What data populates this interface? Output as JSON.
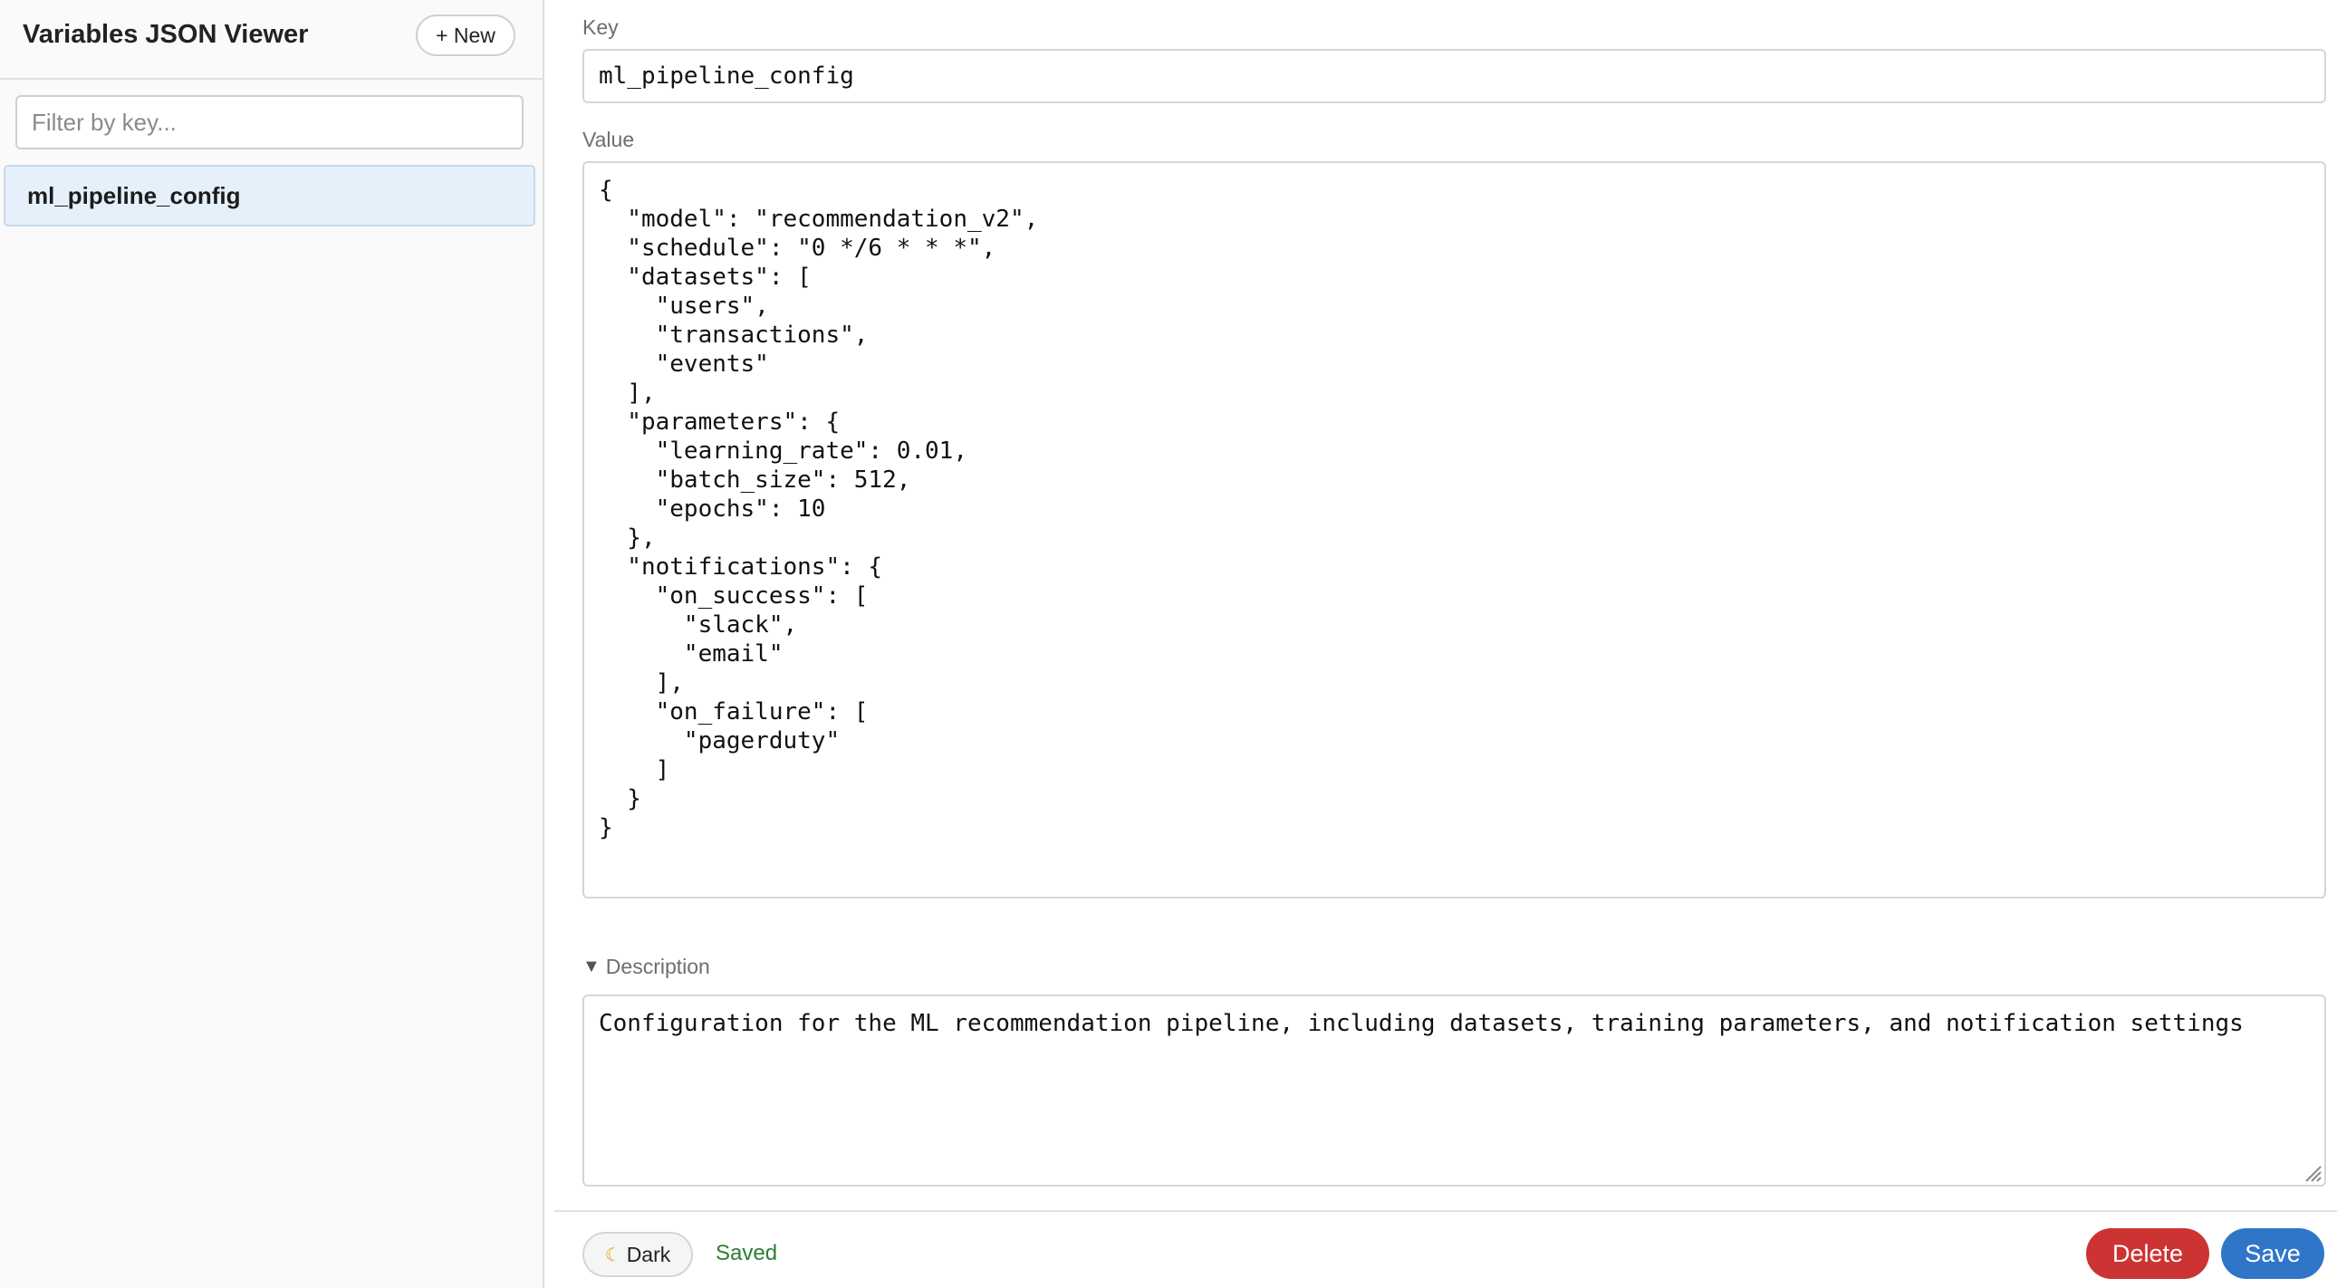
{
  "sidebar": {
    "title": "Variables JSON Viewer",
    "new_button_label": "+ New",
    "filter_placeholder": "Filter by key...",
    "filter_value": "",
    "items": [
      {
        "label": "ml_pipeline_config",
        "selected": true
      }
    ]
  },
  "editor": {
    "key_label": "Key",
    "key_value": "ml_pipeline_config",
    "value_label": "Value",
    "value_text": "{\n  \"model\": \"recommendation_v2\",\n  \"schedule\": \"0 */6 * * *\",\n  \"datasets\": [\n    \"users\",\n    \"transactions\",\n    \"events\"\n  ],\n  \"parameters\": {\n    \"learning_rate\": 0.01,\n    \"batch_size\": 512,\n    \"epochs\": 10\n  },\n  \"notifications\": {\n    \"on_success\": [\n      \"slack\",\n      \"email\"\n    ],\n    \"on_failure\": [\n      \"pagerduty\"\n    ]\n  }\n}",
    "description_toggle_label": "Description",
    "description_expanded": true,
    "description_text": "Configuration for the ML recommendation pipeline, including datasets, training parameters, and notification settings"
  },
  "footer": {
    "theme_button_label": "Dark",
    "status_text": "Saved",
    "delete_label": "Delete",
    "save_label": "Save"
  },
  "icons": {
    "expand": "triangle-down-icon",
    "theme": "moon-icon",
    "resize": "resize-handle-icon"
  },
  "colors": {
    "selected_item_bg": "#e6f0fa",
    "status_saved": "#2e7d32",
    "delete": "#cc3333",
    "save": "#2f76c9"
  }
}
